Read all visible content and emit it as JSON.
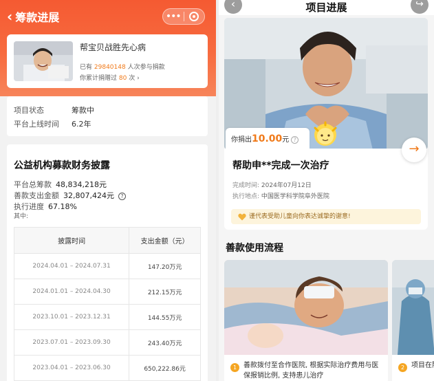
{
  "left": {
    "header": {
      "back_label": "筹款进展"
    },
    "project": {
      "name": "帮宝贝战胜先心病",
      "participants_prefix": "已有",
      "participants_count": "29840148",
      "participants_suffix": "人次参与捐款",
      "user_prefix": "你累计捐赠过",
      "user_count": "80",
      "user_suffix": "次",
      "user_chevron": "›"
    },
    "status": {
      "state_label": "项目状态",
      "state_value": "筹款中",
      "online_label": "平台上线时间",
      "online_value": "6.2年"
    },
    "finance": {
      "title": "公益机构募款财务披露",
      "total_label": "平台总筹款",
      "total_value": "48,834,218元",
      "spent_label": "善款支出金额",
      "spent_value": "32,807,424元",
      "info_icon": "info-icon",
      "progress_label": "执行进度",
      "progress_value": "67.18%",
      "sub_note": "其中:",
      "table_headers": [
        "披露时间",
        "支出金额（元）"
      ],
      "table_rows": [
        {
          "period": "2024.04.01 – 2024.07.31",
          "amount": "147.20万元"
        },
        {
          "period": "2024.01.01 – 2024.04.30",
          "amount": "212.15万元"
        },
        {
          "period": "2023.10.01 – 2023.12.31",
          "amount": "144.55万元"
        },
        {
          "period": "2023.07.01 – 2023.09.30",
          "amount": "243.40万元"
        },
        {
          "period": "2023.04.01 – 2023.06.30",
          "amount": "650,222.86元"
        }
      ]
    }
  },
  "right": {
    "title": "项目进展",
    "back_icon": "chevron-left-icon",
    "share_icon": "share-icon",
    "donated_prefix": "你捐出",
    "donated_amount": "10.00",
    "donated_unit": "元",
    "donated_help": "?",
    "result_title": "帮助申**完成一次治疗",
    "completed_label": "完成时间:",
    "completed_value": "2024年07月12日",
    "location_label": "执行地点:",
    "location_value": "中国医学科学院阜外医院",
    "thanks_text": "谨代表受助儿童向你表达诚挚的谢意!",
    "flow_title": "善款使用流程",
    "flow_steps": [
      {
        "num": "1",
        "text": "善款拨付至合作医院, 根据实际治疗费用与医保报销比例, 支持患儿治疗"
      },
      {
        "num": "2",
        "text": "项目在院方定"
      }
    ]
  },
  "colors": {
    "accent": "#f07a1a",
    "header": "#f55a32",
    "thanks_bg": "#fdf4dc"
  }
}
